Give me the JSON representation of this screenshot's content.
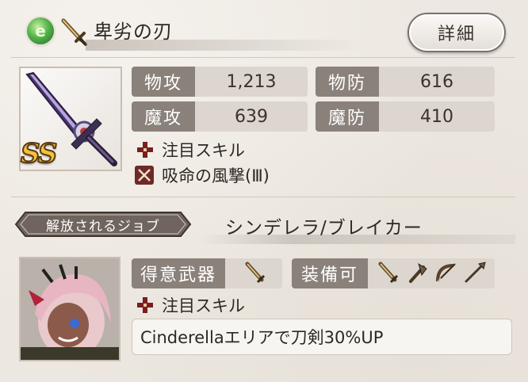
{
  "weapon": {
    "element_icon": "wind-element-icon",
    "type_icon": "sword-icon",
    "name": "卑劣の刃",
    "rarity": "SS"
  },
  "header": {
    "details_label": "詳細"
  },
  "stats": [
    {
      "label": "物攻",
      "value": "1,213"
    },
    {
      "label": "物防",
      "value": "616"
    },
    {
      "label": "魔攻",
      "value": "639"
    },
    {
      "label": "魔防",
      "value": "410"
    }
  ],
  "weapon_skills": [
    {
      "icon": "cross-icon",
      "label": "注目スキル"
    },
    {
      "icon": "crossed-swords-skill-icon",
      "label": "吸命の風撃(Ⅲ)"
    }
  ],
  "job": {
    "tag_label": "解放されるジョブ",
    "name": "シンデレラ/ブレイカー",
    "favorite_weapon_label": "得意武器",
    "favorite_weapon_icons": [
      "sword-icon"
    ],
    "equippable_label": "装備可",
    "equippable_icons": [
      "sword-icon",
      "axe-icon",
      "bow-icon",
      "spear-icon"
    ],
    "skill_header": "注目スキル",
    "skill_note": "Cinderellaエリアで刀剣30%UP"
  },
  "colors": {
    "stat_label_bg": "#8a817a",
    "stat_value_bg": "#dcd6cf",
    "accent_dark_red": "#6e2a26",
    "rarity_gold": "#f2c23b"
  }
}
